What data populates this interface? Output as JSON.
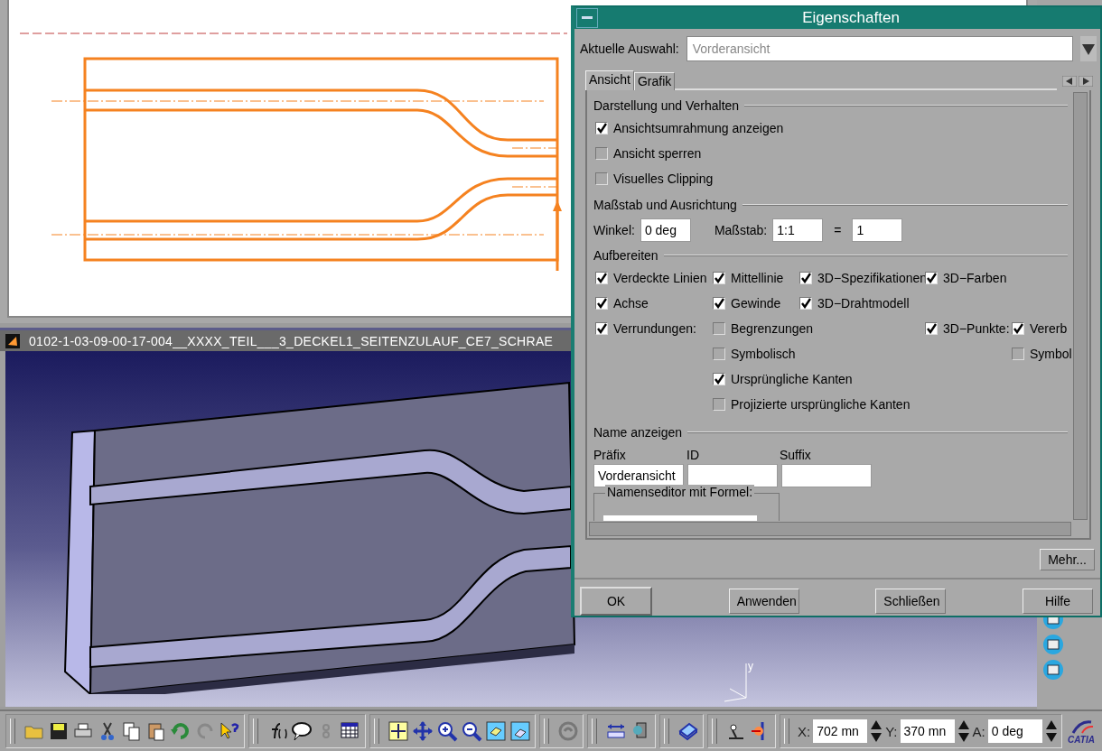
{
  "model_window": {
    "title": "0102-1-03-09-00-17-004__XXXX_TEIL___3_DECKEL1_SEITENZULAUF_CE7_SCHRAE",
    "axis_label": "y"
  },
  "dialog": {
    "title": "Eigenschaften",
    "current_selection": {
      "label": "Aktuelle Auswahl:",
      "value": "Vorderansicht"
    },
    "tabs": [
      {
        "label": "Ansicht",
        "selected": true
      },
      {
        "label": "Grafik",
        "selected": false
      }
    ],
    "display_section": {
      "heading": "Darstellung und Verhalten",
      "options": [
        {
          "label": "Ansichtsumrahmung anzeigen",
          "checked": true
        },
        {
          "label": "Ansicht sperren",
          "checked": false
        },
        {
          "label": "Visuelles Clipping",
          "checked": false
        }
      ]
    },
    "scale_section": {
      "heading": "Maßstab und Ausrichtung",
      "angle_label": "Winkel:",
      "angle_value": "0 deg",
      "scale_label": "Maßstab:",
      "scale_value": "1:1",
      "equals": "=",
      "result_value": "1"
    },
    "generation_section": {
      "heading": "Aufbereiten",
      "rows": [
        [
          {
            "label": "Verdeckte Linien",
            "checked": true
          },
          {
            "label": "Mittellinie",
            "checked": true
          },
          {
            "label": "3D−Spezifikationen",
            "checked": true
          },
          {
            "label": "3D−Farben",
            "checked": true
          }
        ],
        [
          {
            "label": "Achse",
            "checked": true
          },
          {
            "label": "Gewinde",
            "checked": true
          },
          {
            "label": "3D−Drahtmodell",
            "checked": true
          }
        ],
        [
          {
            "label": "Verrundungen:",
            "checked": true
          },
          {
            "label": "Begrenzungen",
            "checked": false
          },
          "",
          {
            "label": "3D−Punkte:",
            "checked": true
          },
          {
            "label": "Vererb",
            "checked": true
          }
        ],
        [
          "",
          {
            "label": "Symbolisch",
            "checked": false
          },
          "",
          "",
          {
            "label": "Symbol",
            "checked": false
          }
        ],
        [
          "",
          {
            "label": "Ursprüngliche Kanten",
            "checked": true
          }
        ],
        [
          "",
          {
            "label": "Projizierte ursprüngliche Kanten",
            "checked": false
          }
        ]
      ]
    },
    "name_section": {
      "heading": "Name anzeigen",
      "fields": [
        {
          "label": "Präfix",
          "value": "Vorderansicht"
        },
        {
          "label": "ID"
        },
        {
          "label": "Suffix"
        }
      ],
      "formula_group": "Namenseditor mit Formel:"
    },
    "more_button": "Mehr...",
    "buttons": [
      "OK",
      "Anwenden",
      "Schließen",
      "Hilfe"
    ]
  },
  "coordinates": [
    {
      "label": "X:",
      "value": "702 mn"
    },
    {
      "label": "Y:",
      "value": "370 mn"
    },
    {
      "label": "A:",
      "value": "0 deg"
    }
  ],
  "logo_text": "CATIA"
}
